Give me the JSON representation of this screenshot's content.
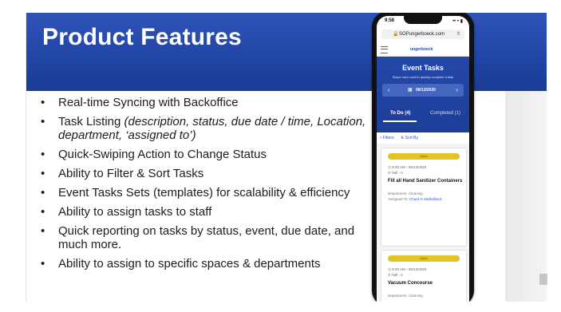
{
  "slide": {
    "title": "Product Features",
    "bullets": [
      {
        "text": "Real-time Syncing with Backoffice"
      },
      {
        "text": "Task Listing ",
        "italic": "(description, status, due date / time, Location, department, ‘assigned to’)"
      },
      {
        "text": "Quick-Swiping Action to Change Status"
      },
      {
        "text": "Ability to Filter & Sort Tasks"
      },
      {
        "text": "Event Tasks Sets (templates) for scalability & efficiency"
      },
      {
        "text": "Ability to assign tasks to staff"
      },
      {
        "text": "Quick reporting on tasks by status, event, due date, and much more."
      },
      {
        "text": "Ability to assign to specific spaces & departments"
      }
    ]
  },
  "phone": {
    "time": "9:58",
    "signal": "•• • ▮",
    "url": "SOPungerboeck.com",
    "logo": "ungerboeck",
    "header_title": "Event Tasks",
    "header_sub": "Swipe each card to quickly complete a task",
    "date": "08/13/2020",
    "tab_todo": "To Do (4)",
    "tab_completed": "Completed (1)",
    "filters": "Filters",
    "sort": "Sort By",
    "cards": [
      {
        "status": "Open",
        "time": "8:00 AM - 08/13/2020",
        "location": "Hall - A",
        "title": "Fill all Hand Sanitizer Containers",
        "department_label": "Department:",
        "department": "Cleaning",
        "assigned_label": "Assigned To:",
        "assignee": "Chuck K Mulholland"
      },
      {
        "status": "Open",
        "time": "8:00 AM - 08/13/2020",
        "location": "Hall - A",
        "title": "Vacuum Concourse",
        "department_label": "Department:",
        "department": "Cleaning",
        "assigned_label": "",
        "assignee": ""
      }
    ]
  },
  "colors": {
    "banner": "#2146a6",
    "pill": "#e3c428",
    "link": "#2a56c6"
  }
}
